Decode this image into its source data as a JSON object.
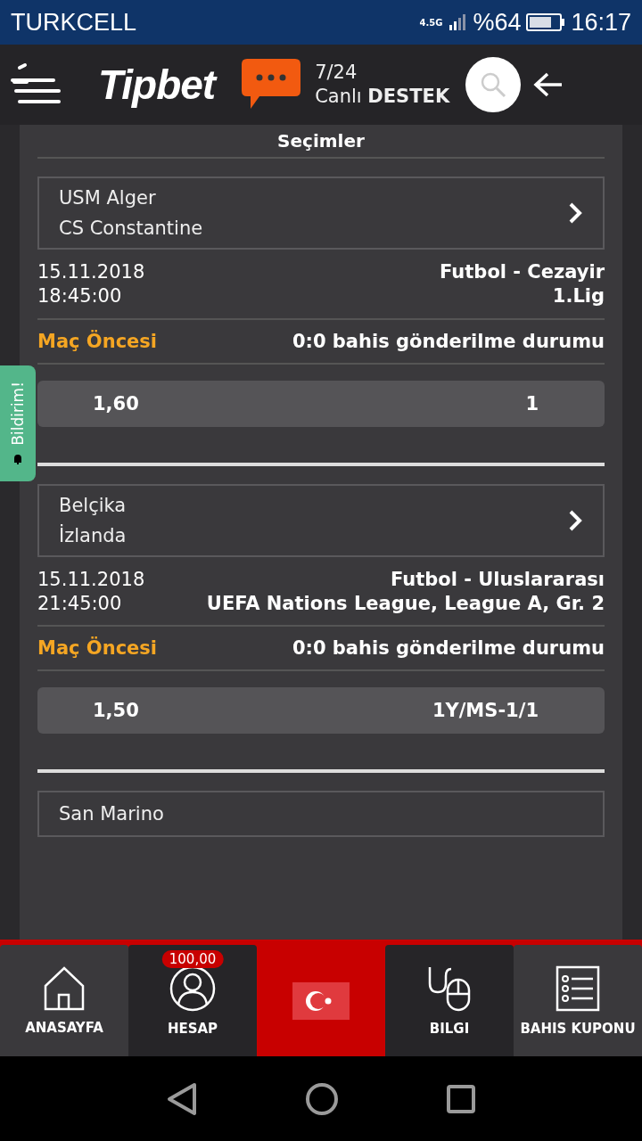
{
  "status_bar": {
    "carrier": "TURKCELL",
    "network": "4.5G",
    "battery": "%64",
    "time": "16:17"
  },
  "header": {
    "logo": "Tipbet",
    "support_hours": "7/24",
    "support_label": "Canlı **DESTEK**"
  },
  "section_title": "Seçimler",
  "bets": [
    {
      "teams": [
        "USM Alger",
        "CS Constantine"
      ],
      "date": "15.11.2018",
      "time": "18:45:00",
      "sport": "Futbol - Cezayir",
      "league": "1.Lig",
      "status": "Maç Öncesi",
      "result": "0:0 bahis gönderilme durumu",
      "odds": "1,60",
      "selection": "1"
    },
    {
      "teams": [
        "Belçika",
        "İzlanda"
      ],
      "date": "15.11.2018",
      "time": "21:45:00",
      "sport": "Futbol - Uluslararası",
      "league": "UEFA Nations League, League A, Gr. 2",
      "status": "Maç Öncesi",
      "result": "0:0 bahis gönderilme durumu",
      "odds": "1,50",
      "selection": "1Y/MS-1/1"
    }
  ],
  "next_match": {
    "teams": [
      "San Marino"
    ]
  },
  "notification_tab": "Bildirim!",
  "bottom_nav": [
    {
      "kind": "home",
      "label": "ANASAYFA"
    },
    {
      "kind": "user",
      "label": "HESAP",
      "badge": "100,00"
    },
    {
      "kind": "flag"
    },
    {
      "kind": "mouse",
      "label": "BILGI"
    },
    {
      "kind": "list",
      "label": "BAHIS KUPONU"
    }
  ]
}
